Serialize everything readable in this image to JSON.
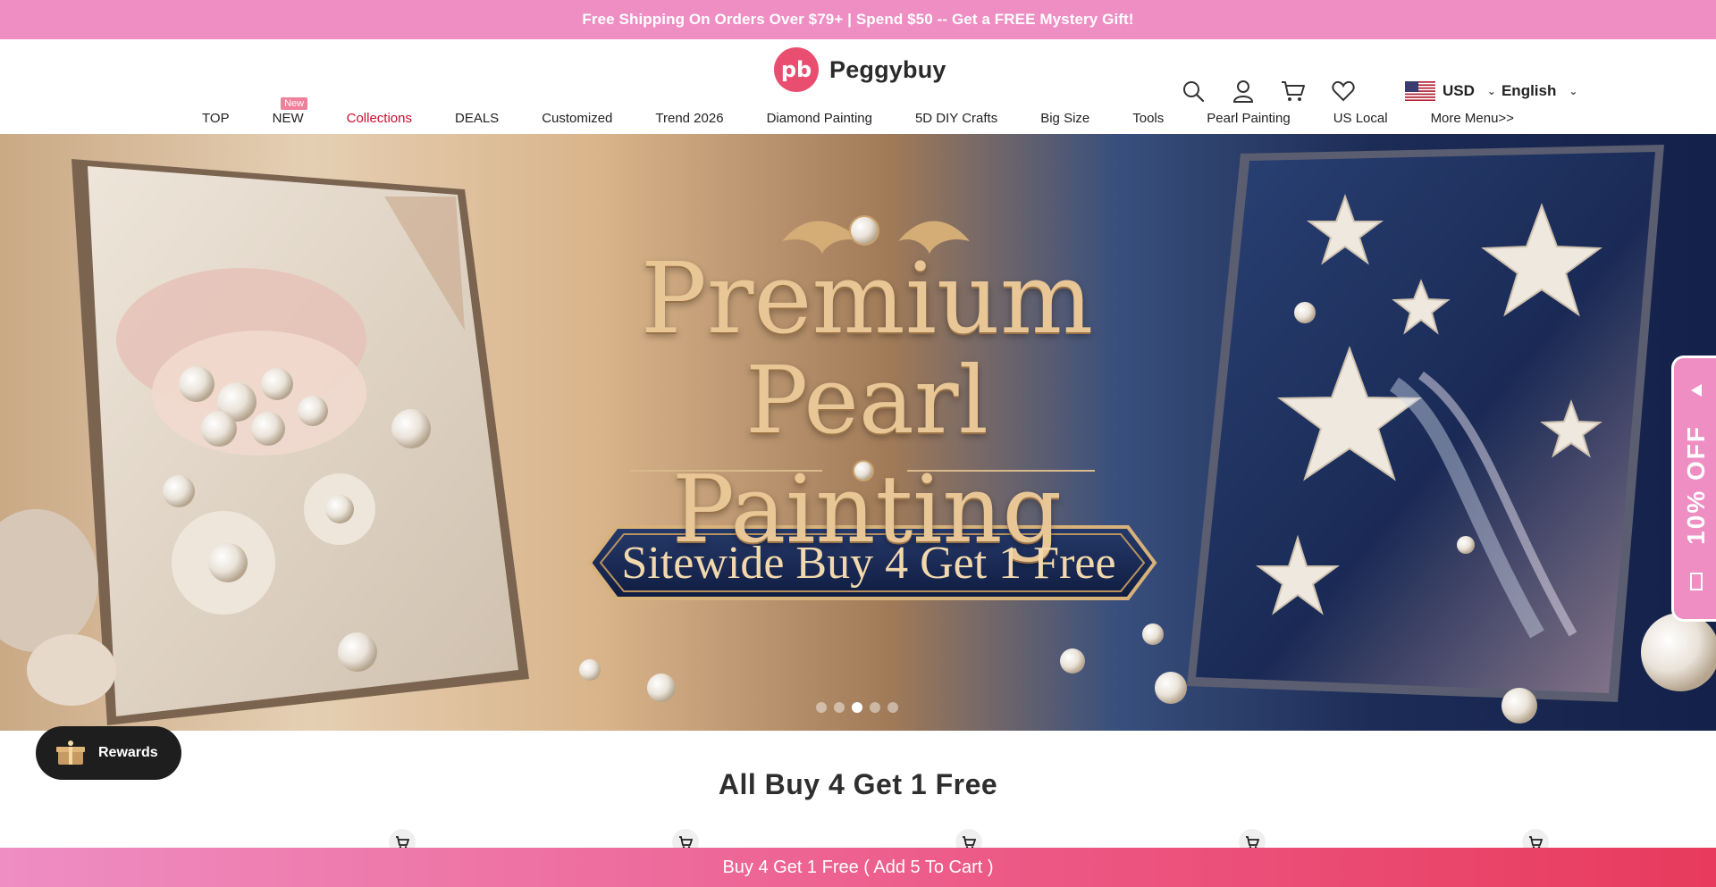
{
  "announcement": "Free Shipping On Orders Over $79+ | Spend $50 -- Get a FREE Mystery Gift!",
  "brand": {
    "logo_text": "Peggybuy",
    "accent": "#e94d6f",
    "pink": "#ee8ec3"
  },
  "header": {
    "icons": [
      "search-icon",
      "account-icon",
      "cart-icon",
      "wishlist-icon"
    ],
    "currency": "USD",
    "language": "English"
  },
  "nav": {
    "items": [
      {
        "label": "TOP"
      },
      {
        "label": "NEW",
        "badge": "New"
      },
      {
        "label": "Collections",
        "active": true
      },
      {
        "label": "DEALS"
      },
      {
        "label": "Customized"
      },
      {
        "label": "Trend 2026"
      },
      {
        "label": "Diamond Painting"
      },
      {
        "label": "5D DIY Crafts"
      },
      {
        "label": "Big Size"
      },
      {
        "label": "Tools"
      },
      {
        "label": "Pearl Painting"
      },
      {
        "label": "US Local"
      },
      {
        "label": "More Menu>>"
      }
    ]
  },
  "hero": {
    "title_line1": "Premium",
    "title_line2": "Pearl Painting",
    "ribbon": "Sitewide Buy 4 Get 1 Free",
    "slides": 5,
    "active_slide": 3
  },
  "side_tab": {
    "label": "10% OFF"
  },
  "rewards": {
    "label": "Rewards"
  },
  "section": {
    "title": "All Buy 4 Get 1 Free"
  },
  "bottom_bar": {
    "label": "Buy 4 Get 1 Free ( Add 5 To Cart )"
  }
}
